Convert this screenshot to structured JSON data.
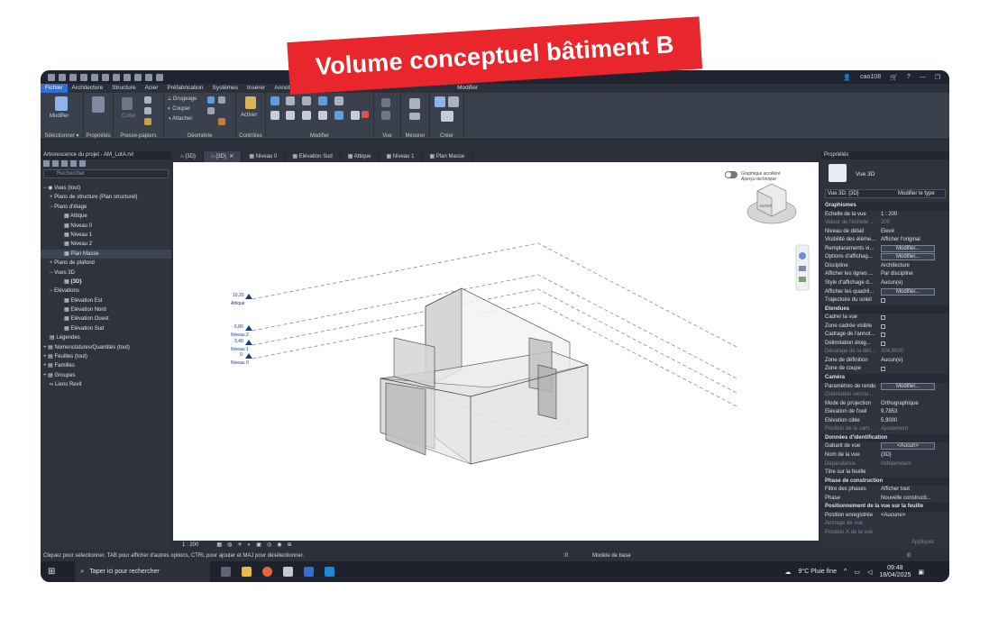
{
  "banner": "Volume conceptuel bâtiment B",
  "titlebar": {
    "user": "cao108"
  },
  "menu_tabs": [
    "Fichier",
    "Architecture",
    "Structure",
    "Acier",
    "Préfabrication",
    "Systèmes",
    "Insérer",
    "Annoter",
    "Modifier"
  ],
  "ribbon": {
    "modify_label": "Modifier",
    "groups": [
      "Sélectionner ▾",
      "Propriétés",
      "Presse-papiers",
      "Géométrie",
      "Contrôles",
      "Modifier",
      "Vue",
      "Mesurer",
      "Créer"
    ],
    "geometry_items": [
      "Grugeage",
      "Couper",
      "Attacher"
    ],
    "activate_label": "Activer",
    "paste_label": "Coller"
  },
  "browser": {
    "title": "Arborescence du projet - AM_LotA.rvt",
    "search_placeholder": "Rechercher",
    "items": [
      "Vues (tout)",
      "Plans de structure (Plan structurel)",
      "Plans d'étage",
      "Attique",
      "Niveau 0",
      "Niveau 1",
      "Niveau 2",
      "Plan Masse",
      "Plans de plafond",
      "Vues 3D",
      "{3D}",
      "Elévations",
      "Elévation Est",
      "Elévation Nord",
      "Elévation Ouest",
      "Elévation Sud",
      "Légendes",
      "Nomenclatures/Quantités (tout)",
      "Feuilles (tout)",
      "Familles",
      "Groupes",
      "Liens Revit"
    ]
  },
  "view_tabs": [
    "{3D}",
    "{3D}",
    "Niveau 0",
    "Elévation Sud",
    "Attique",
    "Niveau 1",
    "Plan Masse"
  ],
  "viewport": {
    "graphics_toggle": "Graphique accéléré",
    "graphics_sub": "Aperçu technique",
    "cube_face": "AVANT",
    "levels": [
      {
        "value": "10,20",
        "name": "Attique"
      },
      {
        "value": "6,80",
        "name": "Niveau 2"
      },
      {
        "value": "3,40",
        "name": "Niveau 1"
      },
      {
        "value": "0",
        "name": "Niveau 0"
      }
    ]
  },
  "view_scale": "1 : 200",
  "properties": {
    "title": "Propriétés",
    "type_name": "Vue 3D",
    "instance_label": "Vue 3D: {3D}",
    "edit_type": "Modifier le type",
    "rows": [
      {
        "section": "Graphismes"
      },
      {
        "k": "Echelle de la vue",
        "v": "1 : 200"
      },
      {
        "k": "Valeur de l'échelle ...",
        "v": "200",
        "grey": true
      },
      {
        "k": "Niveau de détail",
        "v": "Elevé"
      },
      {
        "k": "Visibilité des éléme...",
        "v": "Afficher l'original"
      },
      {
        "k": "Remplacements vi...",
        "v": "Modifier...",
        "btn": true
      },
      {
        "k": "Options d'affichag...",
        "v": "Modifier...",
        "btn": true
      },
      {
        "k": "Discipline",
        "v": "Architecture"
      },
      {
        "k": "Afficher les lignes ...",
        "v": "Par discipline"
      },
      {
        "k": "Style d'affichage d...",
        "v": "Aucun(e)"
      },
      {
        "k": "Afficher les quadril...",
        "v": "Modifier...",
        "btn": true
      },
      {
        "k": "Trajectoire du soleil",
        "v": "",
        "cb": true
      },
      {
        "section": "Etendues"
      },
      {
        "k": "Cadrer la vue",
        "v": "",
        "cb": true
      },
      {
        "k": "Zone cadrée visible",
        "v": "",
        "cb": true
      },
      {
        "k": "Cadrage de l'annot...",
        "v": "",
        "cb": true
      },
      {
        "k": "Délimitation éloig...",
        "v": "",
        "cb": true
      },
      {
        "k": "Décalage de la déli...",
        "v": "304,8000",
        "grey": true
      },
      {
        "k": "Zone de définition",
        "v": "Aucun(e)"
      },
      {
        "k": "Zone de coupe",
        "v": "",
        "cb": true
      },
      {
        "section": "Caméra"
      },
      {
        "k": "Paramètres de rendu",
        "v": "Modifier...",
        "btn": true
      },
      {
        "k": "Orientation verrou...",
        "v": "",
        "grey": true
      },
      {
        "k": "Mode de projection",
        "v": "Orthographique"
      },
      {
        "k": "Elévation de l'oeil",
        "v": "9,7853"
      },
      {
        "k": "Elévation cible",
        "v": "5,9000"
      },
      {
        "k": "Position de la cam...",
        "v": "Ajustement",
        "grey": true
      },
      {
        "section": "Données d'identification"
      },
      {
        "k": "Gabarit de vue",
        "v": "<Aucun>",
        "btn": true
      },
      {
        "k": "Nom de la vue",
        "v": "{3D}"
      },
      {
        "k": "Dépendance",
        "v": "Indépendant",
        "grey": true
      },
      {
        "k": "Titre sur la feuille",
        "v": ""
      },
      {
        "section": "Phase de construction"
      },
      {
        "k": "Filtre des phases",
        "v": "Afficher tout"
      },
      {
        "k": "Phase",
        "v": "Nouvelle constructi..."
      },
      {
        "section": "Positionnement de la vue sur la feuille"
      },
      {
        "k": "Position enregistrée",
        "v": "<Aucune>"
      },
      {
        "k": "Ancrage de vue",
        "v": "",
        "grey": true
      },
      {
        "k": "Position X de la vue",
        "v": "",
        "grey": true
      }
    ],
    "apply": "Appliquer"
  },
  "statusbar": {
    "hint": "Cliquez pour sélectionner, TAB pour afficher d'autres options, CTRL pour ajouter et MAJ pour désélectionner.",
    "model": "Modèle de base",
    "zero1": ":0",
    "zero2": ":0"
  },
  "taskbar": {
    "search": "Taper ici pour rechercher",
    "weather": "9°C  Pluie fine",
    "time": "09:48",
    "date": "18/04/2025"
  }
}
